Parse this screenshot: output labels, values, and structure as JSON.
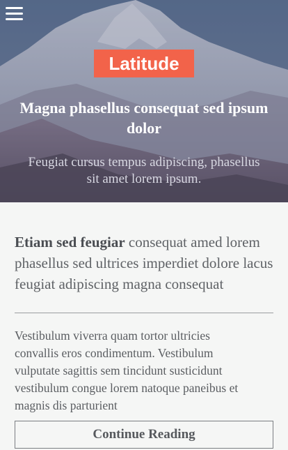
{
  "header": {
    "menu_icon": "hamburger-menu-icon",
    "brand_label": "Latitude",
    "brand_color": "#f2634a"
  },
  "hero": {
    "title": "Magna phasellus consequat sed ipsum dolor",
    "subtitle": "Feugiat cursus tempus adipiscing, phasellus sit amet lorem ipsum."
  },
  "article": {
    "lead_bold": "Etiam sed feugiar",
    "lead_rest": " consequat amed lorem phasellus sed ultrices imperdiet dolore lacus feugiat adipiscing magna consequat",
    "body": "Vestibulum viverra quam tortor ultricies convallis eros condimentum. Vestibulum vulputate sagittis sem tincidunt susticidunt vestibulum congue lorem natoque paneibus et magnis dis parturient",
    "cta_label": "Continue Reading"
  }
}
